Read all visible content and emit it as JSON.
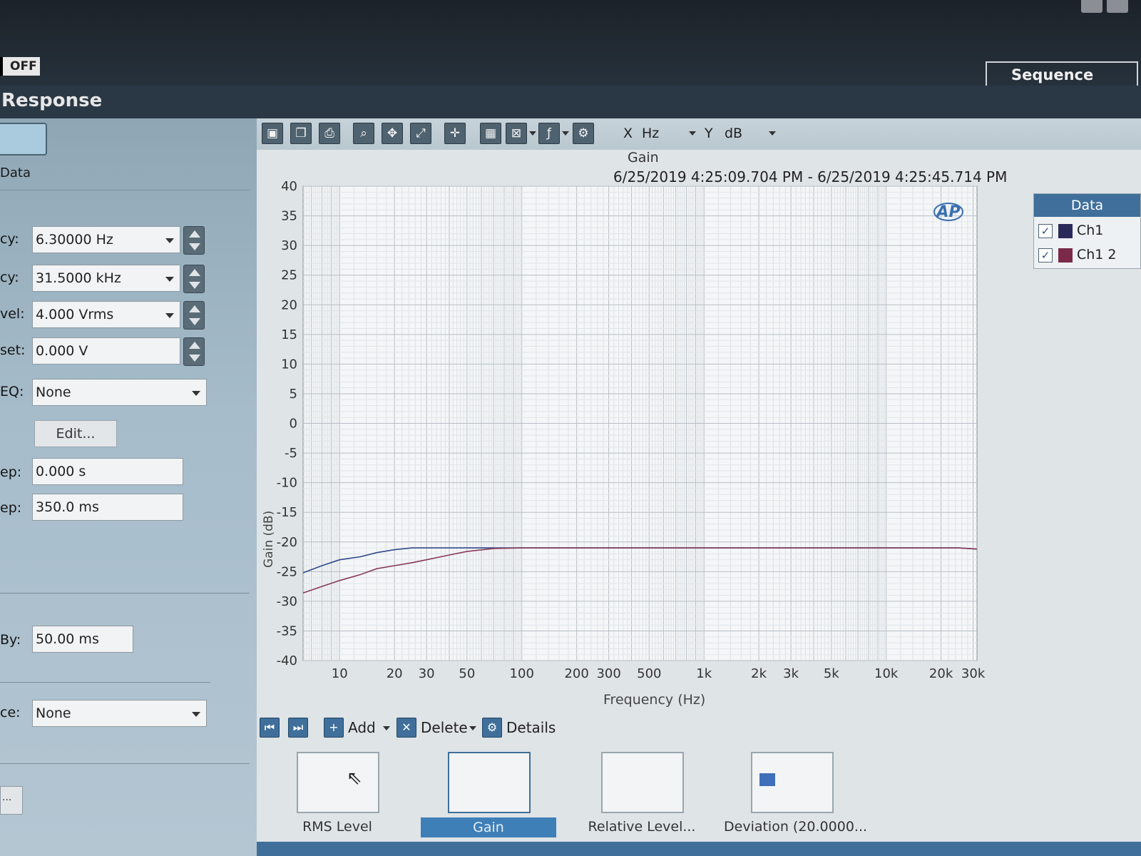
{
  "header": {
    "toggle_label": "OFF",
    "sequence_mode_label": "Sequence Mode",
    "page_title": "Response"
  },
  "left_panel": {
    "data_label": "Data",
    "fields": [
      {
        "label": "cy:",
        "value": "6.30000 Hz"
      },
      {
        "label": "cy:",
        "value": "31.5000 kHz"
      },
      {
        "label": "vel:",
        "value": "4.000 Vrms"
      },
      {
        "label": "set:",
        "value": "0.000 V"
      },
      {
        "label": "EQ:",
        "value": "None"
      },
      {
        "label": "ep:",
        "value": "0.000 s"
      },
      {
        "label": "ep:",
        "value": "350.0 ms"
      },
      {
        "label": "By:",
        "value": "50.00 ms"
      },
      {
        "label": "ce:",
        "value": "None"
      }
    ],
    "edit_label": "Edit...",
    "more_label": "..."
  },
  "toolbar": {
    "x_label": "X",
    "x_unit": "Hz",
    "y_label": "Y",
    "y_unit": "dB",
    "icons": [
      "save-icon",
      "copy-icon",
      "print-icon",
      "zoom-icon",
      "pan-icon",
      "fit-icon",
      "cursor-icon",
      "table-icon",
      "axis-icon",
      "function-icon",
      "gear-icon"
    ]
  },
  "chart_data": {
    "type": "line",
    "title": "Gain",
    "subtitle": "6/25/2019 4:25:09.704 PM - 6/25/2019 4:25:45.714 PM",
    "xlabel": "Frequency (Hz)",
    "ylabel": "Gain (dB)",
    "x_scale": "log",
    "xlim": [
      6.3,
      31500
    ],
    "ylim": [
      -40,
      40
    ],
    "x_ticks": [
      10,
      20,
      30,
      50,
      100,
      200,
      300,
      500,
      1000,
      2000,
      3000,
      5000,
      10000,
      20000,
      30000
    ],
    "x_tick_labels": [
      "10",
      "20",
      "30",
      "50",
      "100",
      "200",
      "300",
      "500",
      "1k",
      "2k",
      "3k",
      "5k",
      "10k",
      "20k",
      "30k"
    ],
    "y_ticks": [
      40,
      35,
      30,
      25,
      20,
      15,
      10,
      5,
      0,
      -5,
      -10,
      -15,
      -20,
      -25,
      -30,
      -35,
      -40
    ],
    "y_tick_labels": [
      "40",
      "35",
      "30",
      "25",
      "20",
      "15",
      "10",
      "5",
      "0",
      "-5",
      "-10",
      "-15",
      "-20",
      "-25",
      "-30",
      "-35",
      "-40"
    ],
    "grid": true,
    "legend_position": "right",
    "series": [
      {
        "name": "Ch1",
        "color": "#2f4a8a",
        "x": [
          6.3,
          8,
          10,
          13,
          16,
          20,
          25,
          30,
          40,
          50,
          70,
          100,
          1000,
          10000,
          25000,
          31500
        ],
        "y": [
          -25.2,
          -24.0,
          -23.0,
          -22.5,
          -21.8,
          -21.3,
          -21.0,
          -21.0,
          -21.0,
          -21.0,
          -21.0,
          -21.0,
          -21.0,
          -21.0,
          -21.0,
          -21.2
        ]
      },
      {
        "name": "Ch1 2",
        "color": "#8a3a5a",
        "x": [
          6.3,
          8,
          10,
          13,
          16,
          20,
          25,
          30,
          40,
          50,
          70,
          100,
          1000,
          10000,
          25000,
          31500
        ],
        "y": [
          -28.6,
          -27.5,
          -26.5,
          -25.5,
          -24.5,
          -24.0,
          -23.5,
          -23.0,
          -22.2,
          -21.6,
          -21.1,
          -21.0,
          -21.0,
          -21.0,
          -21.0,
          -21.2
        ]
      }
    ]
  },
  "legend": {
    "header": "Data",
    "items": [
      {
        "label": "Ch1",
        "checked": "✓",
        "color": "#2a2a5a"
      },
      {
        "label": "Ch1 2",
        "checked": "✓",
        "color": "#7a2a48"
      }
    ]
  },
  "nav": {
    "add_label": "Add",
    "delete_label": "Delete",
    "details_label": "Details"
  },
  "thumbnails": [
    {
      "label": "RMS Level"
    },
    {
      "label": "Gain"
    },
    {
      "label": "Relative Level..."
    },
    {
      "label": "Deviation (20.0000..."
    }
  ]
}
